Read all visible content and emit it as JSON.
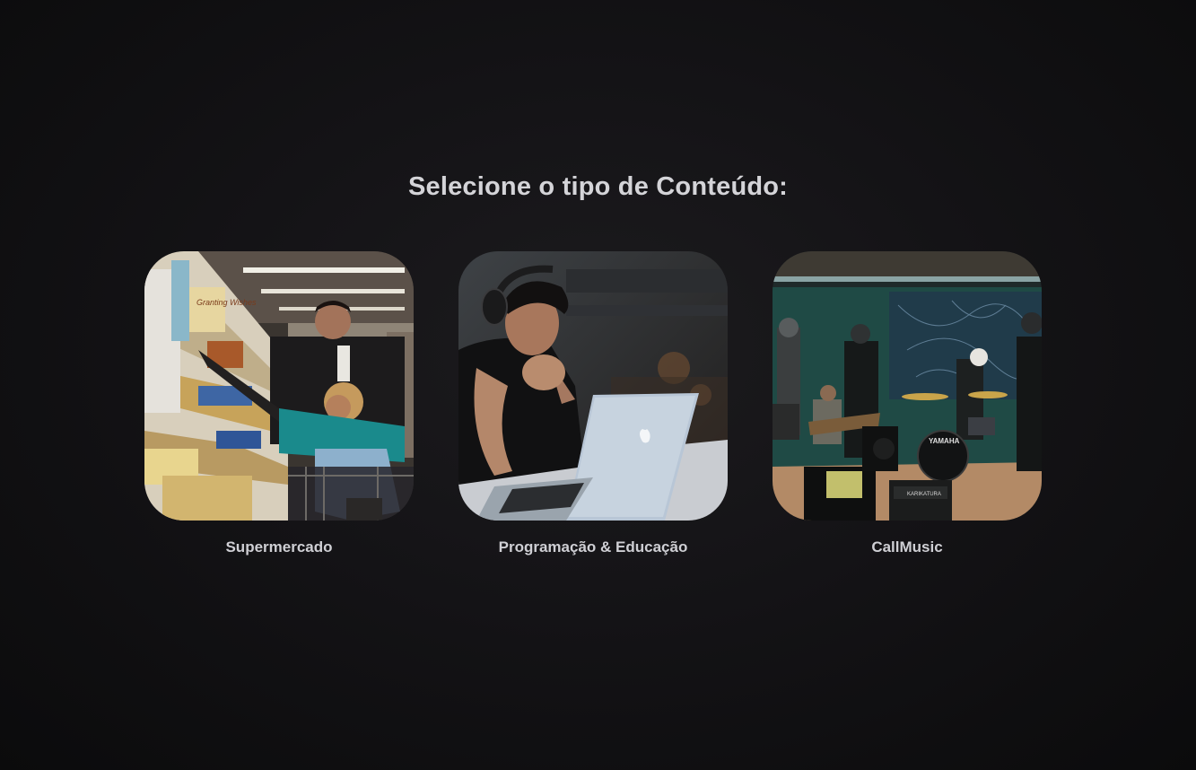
{
  "page": {
    "title": "Selecione o tipo de Conteúdo:"
  },
  "cards": [
    {
      "label": "Supermercado",
      "image": "supermarket-aisle-photo"
    },
    {
      "label": "Programação & Educação",
      "image": "person-with-headphones-laptop-photo"
    },
    {
      "label": "CallMusic",
      "image": "band-rehearsal-photo"
    }
  ],
  "photo_text": {
    "shelf_box": "Granting Wishes",
    "drum_brand": "YAMAHA",
    "sign": "KARIKATURA"
  },
  "colors": {
    "background": "#141316",
    "title": "#d4d4d8",
    "label": "#cfcfd4"
  }
}
